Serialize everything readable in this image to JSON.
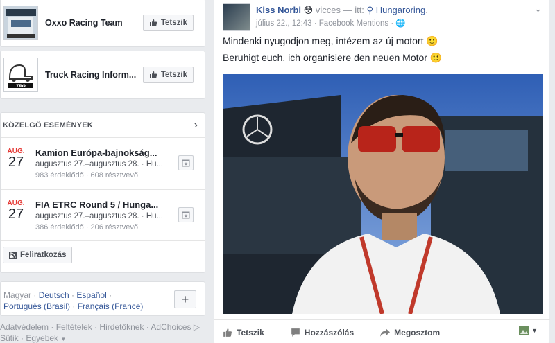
{
  "pages": [
    {
      "name": "Oxxo Racing Team",
      "like_label": "Tetszik",
      "thumb_icon": "oxxo-truck-thumbnail"
    },
    {
      "name": "Truck Racing Inform...",
      "like_label": "Tetszik",
      "thumb_icon": "tro-logo-thumbnail"
    }
  ],
  "events": {
    "title": "KÖZELGŐ ESEMÉNYEK",
    "items": [
      {
        "month": "AUG.",
        "day": "27",
        "title": "Kamion Európa-bajnokság...",
        "dates": "augusztus 27.–augusztus 28. · Hu...",
        "stats": "983 érdeklődő · 608 résztvevő"
      },
      {
        "month": "AUG.",
        "day": "27",
        "title": "FIA ETRC Round 5 / Hunga...",
        "dates": "augusztus 27.–augusztus 28. · Hu...",
        "stats": "386 érdeklődő · 206 résztvevő"
      }
    ],
    "subscribe_label": "Feliratkozás"
  },
  "languages": {
    "current": "Magyar",
    "options": [
      "Deutsch",
      "Español",
      "Português (Brasil)",
      "Français (France)"
    ]
  },
  "footer": {
    "links_line1": "Adatvédelem · Feltételek · Hirdetőknek · AdChoices",
    "links_line2": "Sütik · Egyebek"
  },
  "post": {
    "author": "Kiss Norbi",
    "feeling": "vicces",
    "at_label": "— itt:",
    "location": "Hungaroring",
    "meta": "július 22., 12:43 · Facebook Mentions ·",
    "text_hu": "Mindenki nyugodjon meg, intézem az új motort 🙂",
    "text_de": "Beruhigt euch, ich organisiere den neuen Motor 🙂",
    "actions": {
      "like": "Tetszik",
      "comment": "Hozzászólás",
      "share": "Megosztom"
    }
  },
  "colors": {
    "link": "#365899",
    "accent_red": "#e53935",
    "bg": "#e9ebee"
  }
}
